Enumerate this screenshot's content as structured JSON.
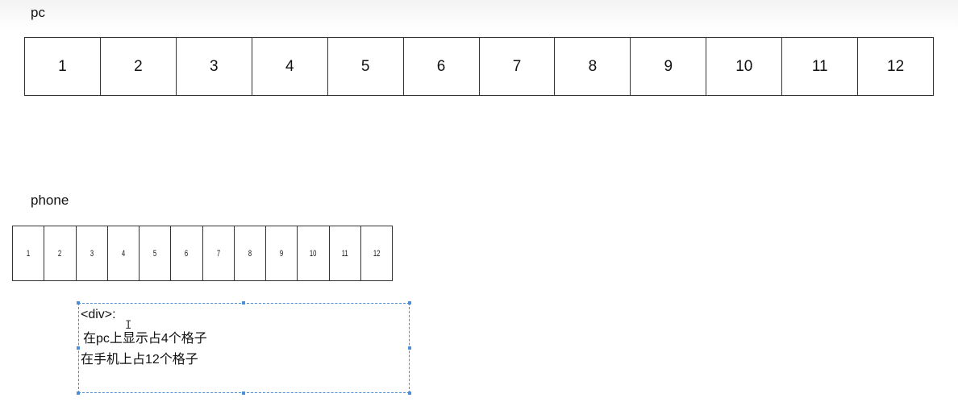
{
  "pc": {
    "label": "pc",
    "cells": [
      "1",
      "2",
      "3",
      "4",
      "5",
      "6",
      "7",
      "8",
      "9",
      "10",
      "11",
      "12"
    ]
  },
  "phone": {
    "label": "phone",
    "cells": [
      "1",
      "2",
      "3",
      "4",
      "5",
      "6",
      "7",
      "8",
      "9",
      "10",
      "11",
      "12"
    ]
  },
  "note": {
    "line1": "<div>:",
    "line2": "在pc上显示占4个格子",
    "line3": "在手机上占12个格子"
  },
  "colors": {
    "grid_border": "#333333",
    "selection": "#4a8fd6"
  }
}
